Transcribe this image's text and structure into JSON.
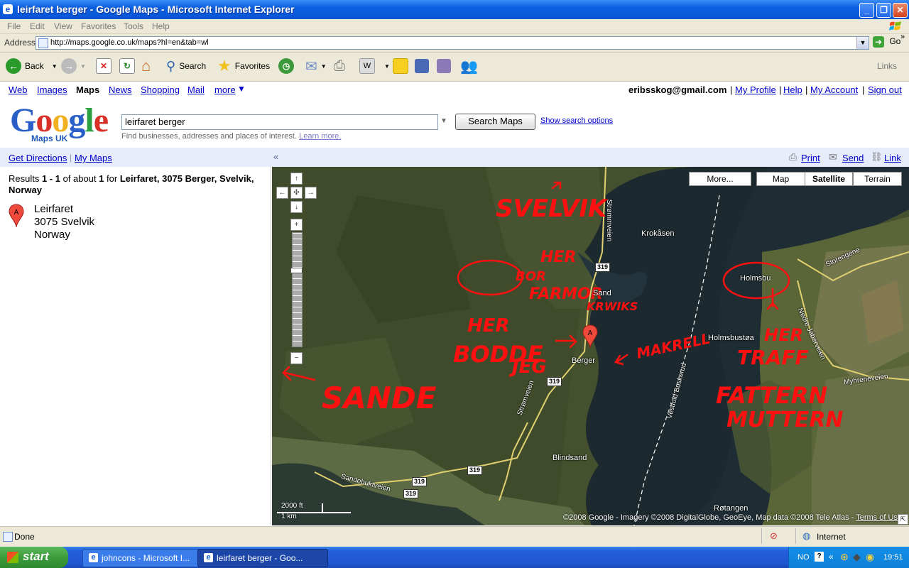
{
  "window": {
    "title": "leirfaret berger - Google Maps - Microsoft Internet Explorer"
  },
  "menu": [
    "File",
    "Edit",
    "View",
    "Favorites",
    "Tools",
    "Help"
  ],
  "address": {
    "label": "Address",
    "url": "http://maps.google.co.uk/maps?hl=en&tab=wl",
    "go": "Go"
  },
  "toolbar": {
    "back": "Back",
    "search": "Search",
    "favorites": "Favorites",
    "links": "Links"
  },
  "gnav": {
    "items": [
      "Web",
      "Images",
      "Maps",
      "News",
      "Shopping",
      "Mail",
      "more"
    ],
    "user": "eribsskog@gmail.com",
    "right_links": [
      "My Profile",
      "Help",
      "My Account",
      "Sign out"
    ]
  },
  "logo": {
    "text": "Google",
    "sub": "Maps UK"
  },
  "search": {
    "value": "leirfaret berger",
    "button": "Search Maps",
    "options": "Show search options",
    "hint": "Find businesses, addresses and places of interest.",
    "learn_more": "Learn more."
  },
  "dirbar": {
    "directions": "Get Directions",
    "mymaps": "My Maps",
    "print": "Print",
    "send": "Send",
    "link": "Link"
  },
  "results": {
    "summary_pre": "Results ",
    "range": "1 - 1",
    "of_about": " of about ",
    "count": "1",
    "for": " for ",
    "query": "Leirfaret, 3075 Berger, Svelvik, Norway",
    "item": {
      "marker": "A",
      "name": "Leirfaret",
      "line2": "3075 Svelvik",
      "line3": "Norway"
    }
  },
  "map": {
    "types": {
      "more": "More...",
      "map": "Map",
      "satellite": "Satellite",
      "terrain": "Terrain"
    },
    "places": [
      "Krokåsen",
      "Sand",
      "Holmsbu",
      "Holmsbustøa",
      "Berger",
      "Blindsand",
      "Røtangen",
      "Strømmveien",
      "Storengene",
      "Nedre Jaberveien",
      "Myhreneveien",
      "Strømveien",
      "Sandebuktveien",
      "Vestfold Buskerud"
    ],
    "route_shields": [
      "319",
      "319",
      "319",
      "319",
      "319"
    ],
    "scale": {
      "ft": "2000 ft",
      "km": "1 km"
    },
    "copyright": "©2008 Google - Imagery ©2008 DigitalGlobe, GeoEye, Map data ©2008 Tele Atlas - ",
    "terms": "Terms of Use",
    "marker": "A",
    "annotations": [
      "SVELVIK",
      "HER",
      "BOR",
      "FARMOR",
      "KRWIKS",
      "HER",
      "BODDE",
      "JEG",
      "MAKRELL",
      "HER",
      "TRAFF",
      "FATTERN",
      "MUTTERN",
      "SANDE"
    ]
  },
  "status": {
    "text": "Done",
    "zone": "Internet"
  },
  "taskbar": {
    "start": "start",
    "tasks": [
      "johncons - Microsoft I...",
      "leirfaret berger - Goo..."
    ],
    "lang": "NO",
    "time": "19:51"
  }
}
